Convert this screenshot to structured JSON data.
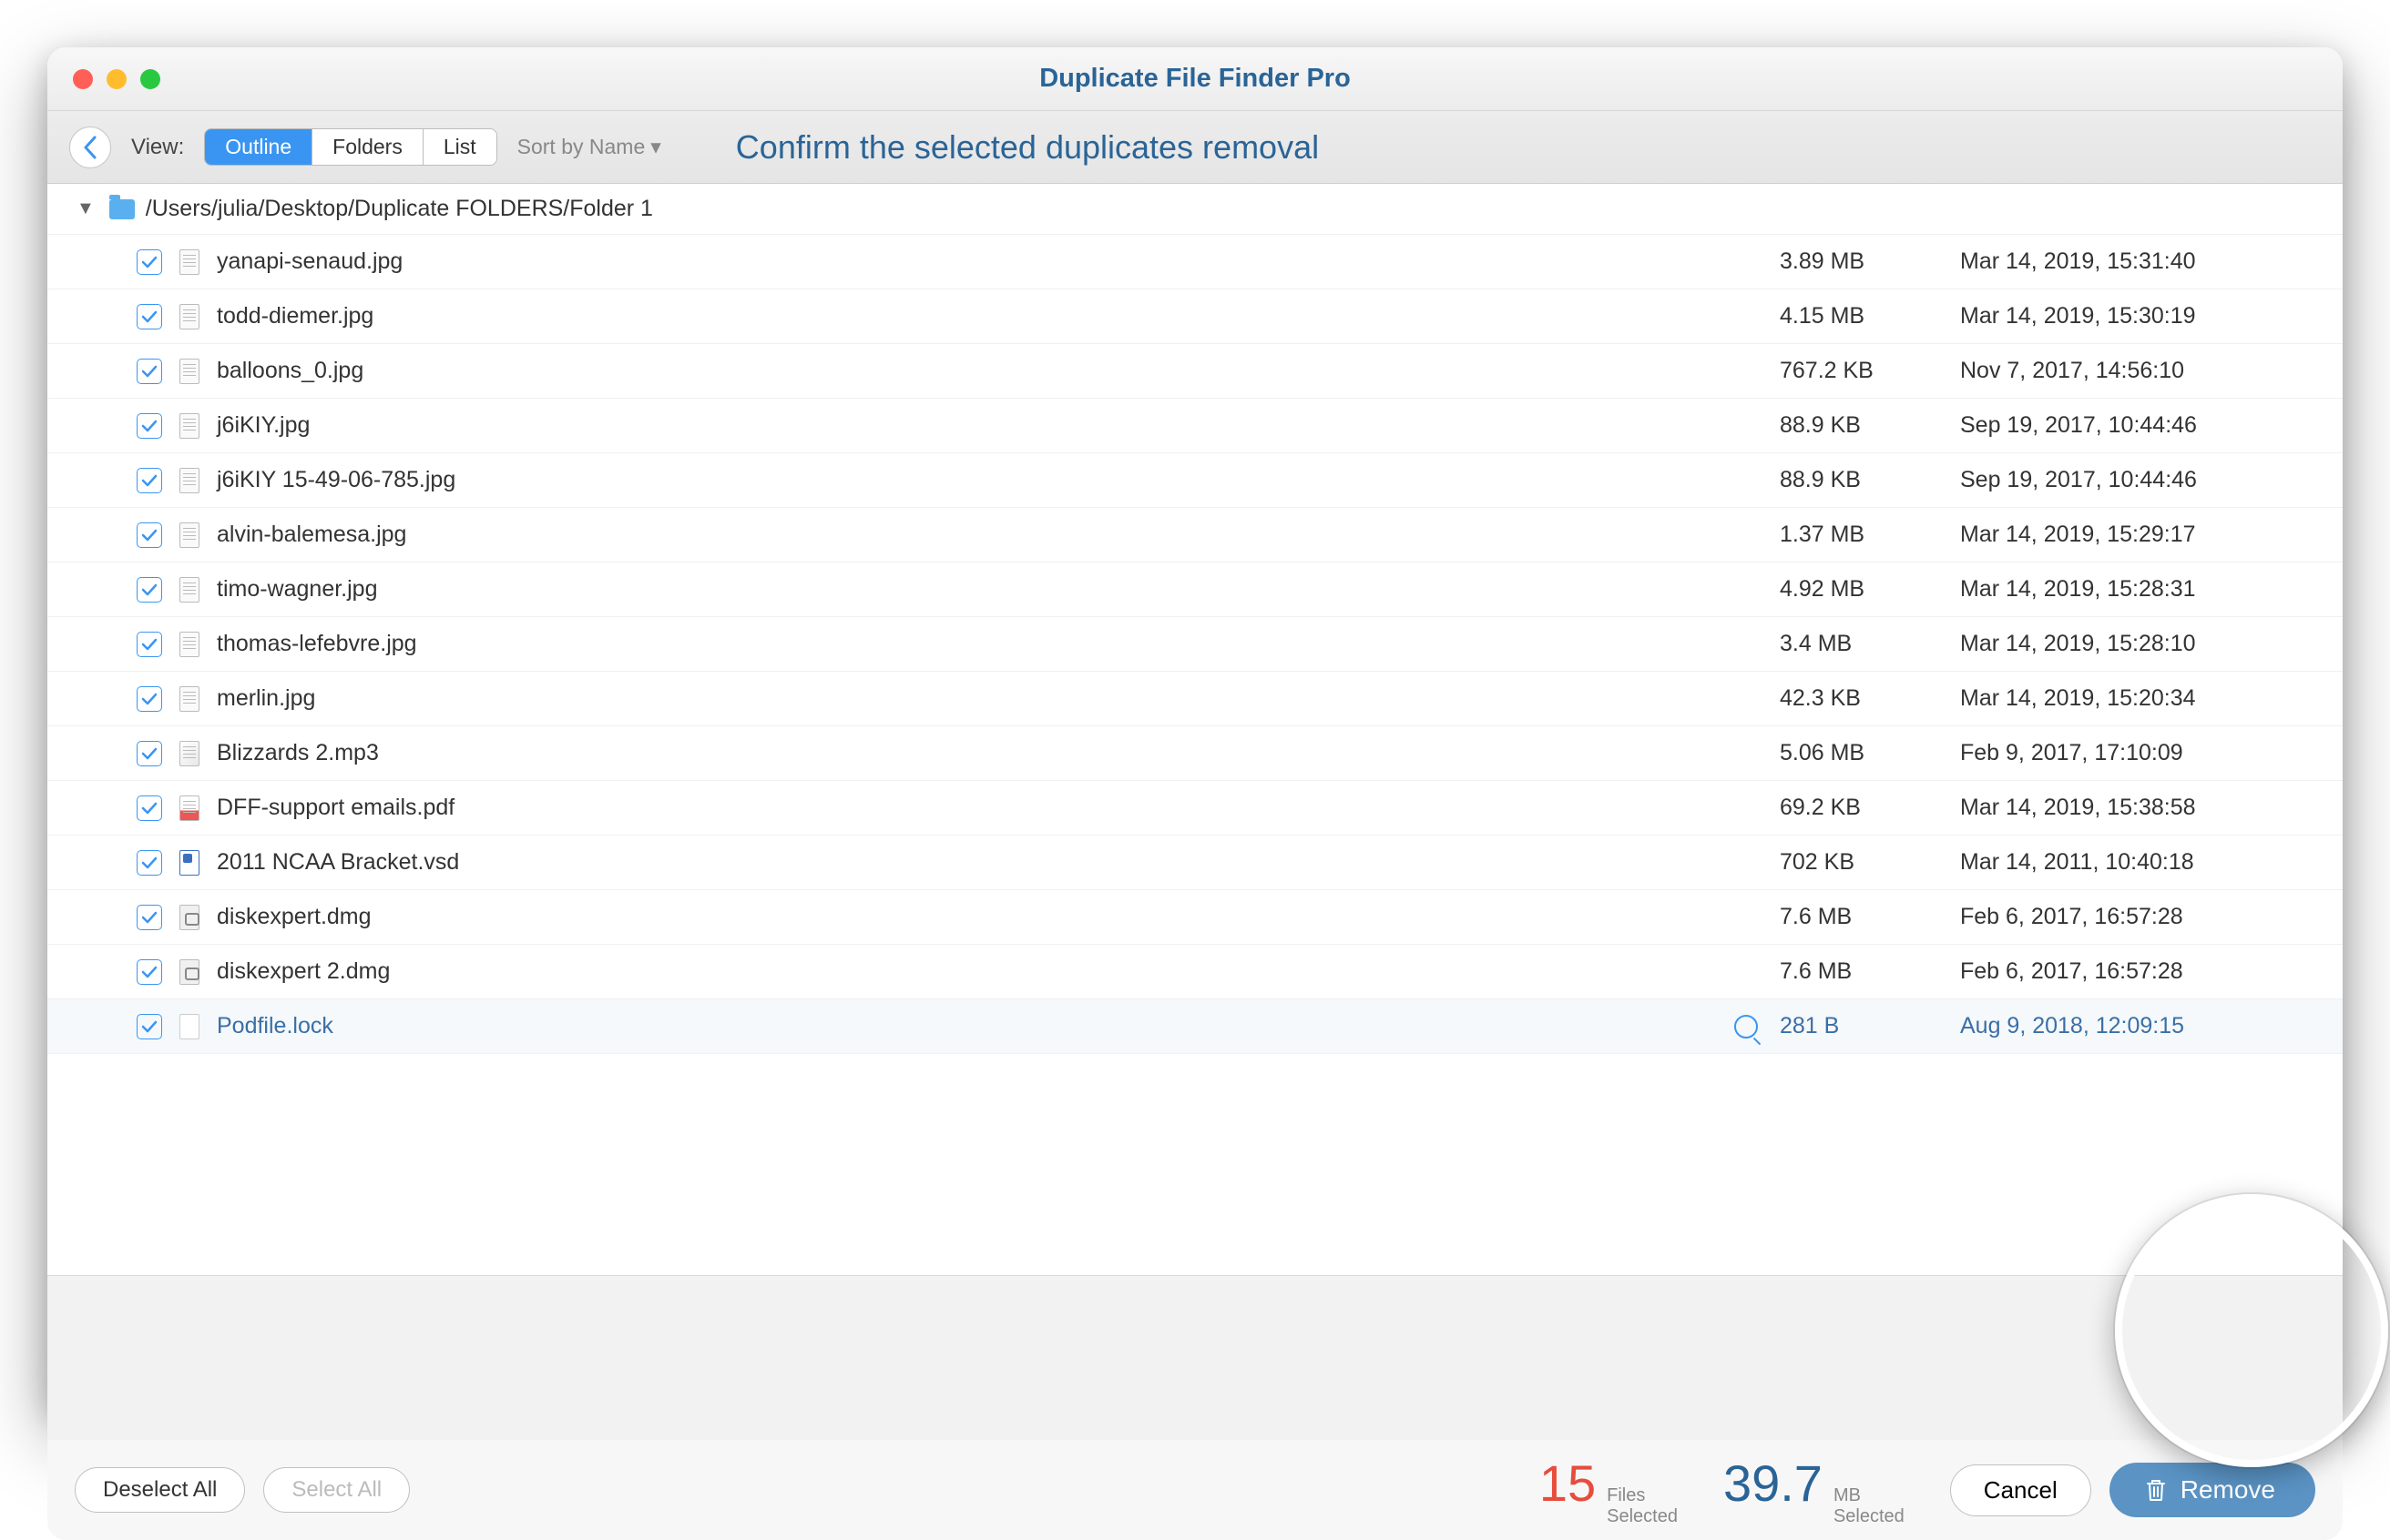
{
  "title": "Duplicate File Finder Pro",
  "toolbar": {
    "view_label": "View:",
    "segments": [
      "Outline",
      "Folders",
      "List"
    ],
    "active_segment": 0,
    "sort_label": "Sort by Name",
    "heading": "Confirm the selected duplicates removal"
  },
  "folder": {
    "path": "/Users/julia/Desktop/Duplicate FOLDERS/Folder 1"
  },
  "files": [
    {
      "name": "yanapi-senaud.jpg",
      "size": "3.89 MB",
      "date": "Mar 14, 2019, 15:31:40",
      "icon": "img"
    },
    {
      "name": "todd-diemer.jpg",
      "size": "4.15 MB",
      "date": "Mar 14, 2019, 15:30:19",
      "icon": "img"
    },
    {
      "name": "balloons_0.jpg",
      "size": "767.2 KB",
      "date": "Nov 7, 2017, 14:56:10",
      "icon": "img"
    },
    {
      "name": "j6iKIY.jpg",
      "size": "88.9 KB",
      "date": "Sep 19, 2017, 10:44:46",
      "icon": "img"
    },
    {
      "name": "j6iKIY 15-49-06-785.jpg",
      "size": "88.9 KB",
      "date": "Sep 19, 2017, 10:44:46",
      "icon": "img"
    },
    {
      "name": "alvin-balemesa.jpg",
      "size": "1.37 MB",
      "date": "Mar 14, 2019, 15:29:17",
      "icon": "img"
    },
    {
      "name": "timo-wagner.jpg",
      "size": "4.92 MB",
      "date": "Mar 14, 2019, 15:28:31",
      "icon": "img"
    },
    {
      "name": "thomas-lefebvre.jpg",
      "size": "3.4 MB",
      "date": "Mar 14, 2019, 15:28:10",
      "icon": "img"
    },
    {
      "name": "merlin.jpg",
      "size": "42.3 KB",
      "date": "Mar 14, 2019, 15:20:34",
      "icon": "img"
    },
    {
      "name": "Blizzards 2.mp3",
      "size": "5.06 MB",
      "date": "Feb 9, 2017, 17:10:09",
      "icon": "audio"
    },
    {
      "name": "DFF-support emails.pdf",
      "size": "69.2 KB",
      "date": "Mar 14, 2019, 15:38:58",
      "icon": "pdf"
    },
    {
      "name": "2011 NCAA Bracket.vsd",
      "size": "702 KB",
      "date": "Mar 14, 2011, 10:40:18",
      "icon": "vsd"
    },
    {
      "name": "diskexpert.dmg",
      "size": "7.6 MB",
      "date": "Feb 6, 2017, 16:57:28",
      "icon": "dmg"
    },
    {
      "name": "diskexpert 2.dmg",
      "size": "7.6 MB",
      "date": "Feb 6, 2017, 16:57:28",
      "icon": "dmg"
    },
    {
      "name": "Podfile.lock",
      "size": "281 B",
      "date": "Aug 9, 2018, 12:09:15",
      "icon": "generic",
      "magnify": true,
      "selected": true
    }
  ],
  "footer": {
    "deselect_label": "Deselect All",
    "select_label": "Select All",
    "files_count": "15",
    "files_label_1": "Files",
    "files_label_2": "Selected",
    "size_value": "39.7",
    "size_label_1": "MB",
    "size_label_2": "Selected",
    "cancel_label": "Cancel",
    "remove_label": "Remove"
  }
}
